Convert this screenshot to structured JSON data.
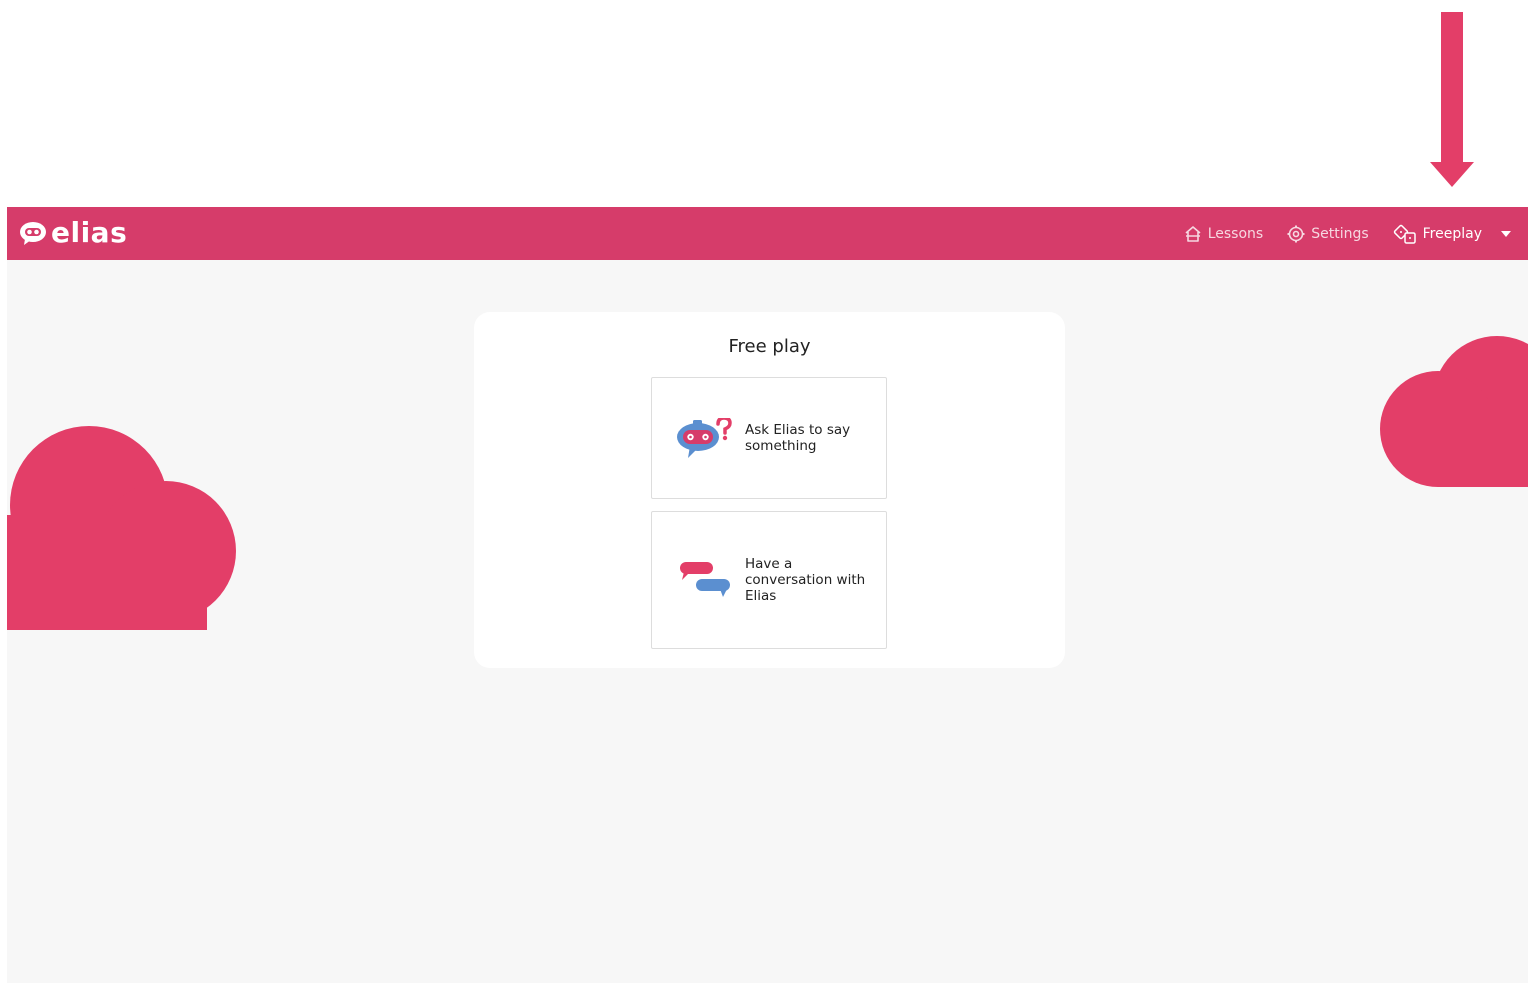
{
  "colors": {
    "brand": "#d63c6a",
    "cloud": "#e33e68",
    "annotation_arrow": "#e33e68",
    "background": "#f7f7f7",
    "bubble_blue": "#5b8fd0"
  },
  "header": {
    "logo_text": "elias",
    "nav": [
      {
        "label": "Lessons",
        "icon": "home-icon"
      },
      {
        "label": "Settings",
        "icon": "gear-icon"
      },
      {
        "label": "Freeplay",
        "icon": "dice-icon",
        "active": true
      }
    ],
    "dropdown_icon": "caret-down-icon"
  },
  "main": {
    "title": "Free play",
    "cards": [
      {
        "label": "Ask Elias to say something",
        "icon": "robot-question-icon"
      },
      {
        "label": "Have a conversation with Elias",
        "icon": "chat-bubbles-icon"
      }
    ]
  }
}
